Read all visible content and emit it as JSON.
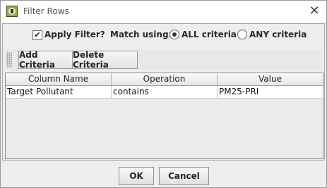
{
  "window": {
    "title": "Filter Rows",
    "close_symbol": "✕"
  },
  "filter": {
    "apply_checked": true,
    "apply_label": "Apply Filter?",
    "match_label": "Match using:",
    "options": [
      {
        "label": "ALL criteria",
        "selected": true
      },
      {
        "label": "ANY criteria",
        "selected": false
      }
    ]
  },
  "toolbar": {
    "add_label": "Add Criteria",
    "delete_label": "Delete Criteria"
  },
  "table": {
    "columns": [
      "Column Name",
      "Operation",
      "Value"
    ],
    "rows": [
      [
        "Target Pollutant",
        "contains",
        "PM25-PRI"
      ]
    ]
  },
  "buttons": {
    "ok_label": "OK",
    "cancel_label": "Cancel"
  },
  "icons": {
    "app": "app-icon",
    "close": "close-icon",
    "check": "checkmark-icon"
  }
}
